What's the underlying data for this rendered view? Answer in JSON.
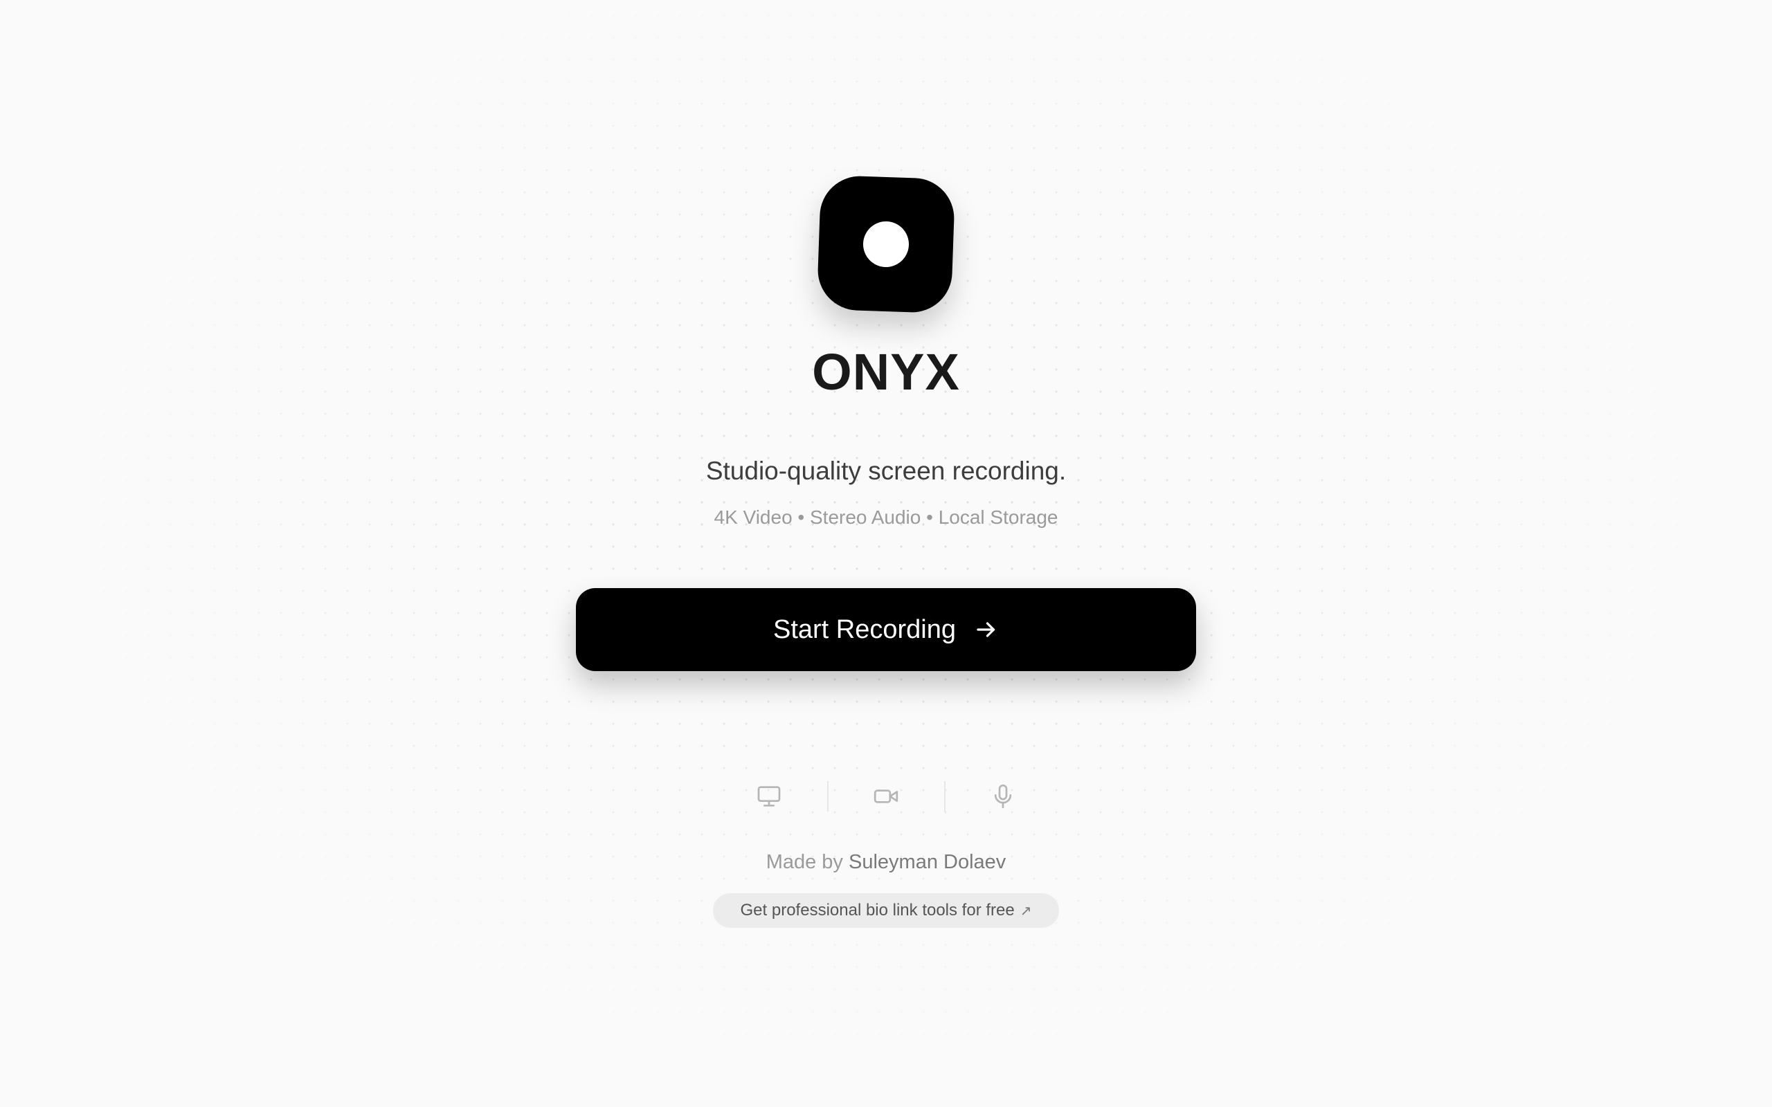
{
  "app": {
    "name": "ONYX",
    "tagline": "Studio-quality screen recording.",
    "features_line": "4K Video • Stereo Audio • Local Storage"
  },
  "cta": {
    "label": "Start Recording",
    "icon": "arrow-right-icon"
  },
  "modes": [
    {
      "name": "screen",
      "icon": "monitor-icon"
    },
    {
      "name": "camera",
      "icon": "video-camera-icon"
    },
    {
      "name": "microphone",
      "icon": "microphone-icon"
    }
  ],
  "footer": {
    "credit_prefix": "Made by",
    "credit_author": "Suleyman Dolaev",
    "promo_label": "Get professional bio link tools for free",
    "promo_icon": "external-link-icon"
  },
  "colors": {
    "background": "#fafafa",
    "primary": "#000000",
    "primary_text": "#ffffff",
    "muted_text": "#9a9a9a"
  }
}
